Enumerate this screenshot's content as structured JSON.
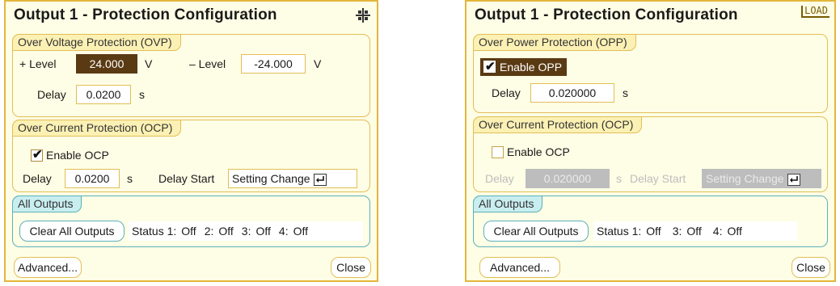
{
  "panel1": {
    "title": "Output 1 - Protection Configuration",
    "ovp": {
      "label": "Over Voltage Protection (OVP)",
      "plus_level_label": "+ Level",
      "plus_level_value": "24.000",
      "plus_unit": "V",
      "minus_level_label": "– Level",
      "minus_level_value": "-24.000",
      "minus_unit": "V",
      "delay_label": "Delay",
      "delay_value": "0.0200",
      "delay_unit": "s"
    },
    "ocp": {
      "label": "Over Current Protection (OCP)",
      "enable_label": "Enable OCP",
      "enabled": true,
      "delay_label": "Delay",
      "delay_value": "0.0200",
      "delay_unit": "s",
      "delay_start_label": "Delay Start",
      "delay_start_value": "Setting Change"
    },
    "all_outputs": {
      "label": "All Outputs",
      "clear_button": "Clear All Outputs",
      "status_label": "Status 1:",
      "statuses": [
        "Off",
        "2:",
        "Off",
        "3:",
        "Off",
        "4:",
        "Off"
      ]
    },
    "advanced_button": "Advanced...",
    "close_button": "Close"
  },
  "panel2": {
    "title": "Output 1 - Protection Configuration",
    "corner_text": "LOAD",
    "opp": {
      "label": "Over Power Protection (OPP)",
      "enable_label": "Enable OPP",
      "enabled": true,
      "delay_label": "Delay",
      "delay_value": "0.020000",
      "delay_unit": "s"
    },
    "ocp": {
      "label": "Over Current Protection (OCP)",
      "enable_label": "Enable OCP",
      "enabled": false,
      "delay_label": "Delay",
      "delay_value": "0.020000",
      "delay_unit": "s",
      "delay_start_label": "Delay Start",
      "delay_start_value": "Setting Change"
    },
    "all_outputs": {
      "label": "All Outputs",
      "clear_button": "Clear All Outputs",
      "status_label": "Status 1:",
      "statuses": [
        "Off",
        "3:",
        "Off",
        "4:",
        "Off"
      ]
    },
    "advanced_button": "Advanced...",
    "close_button": "Close"
  },
  "colors": {
    "panel_bg": "#fefee6",
    "panel_border": "#e3b63c",
    "group_border": "#e2be55",
    "teal_border": "#5cb0b8",
    "selected_bg": "#5a3a13",
    "disabled_bg": "#bdbdbd"
  }
}
